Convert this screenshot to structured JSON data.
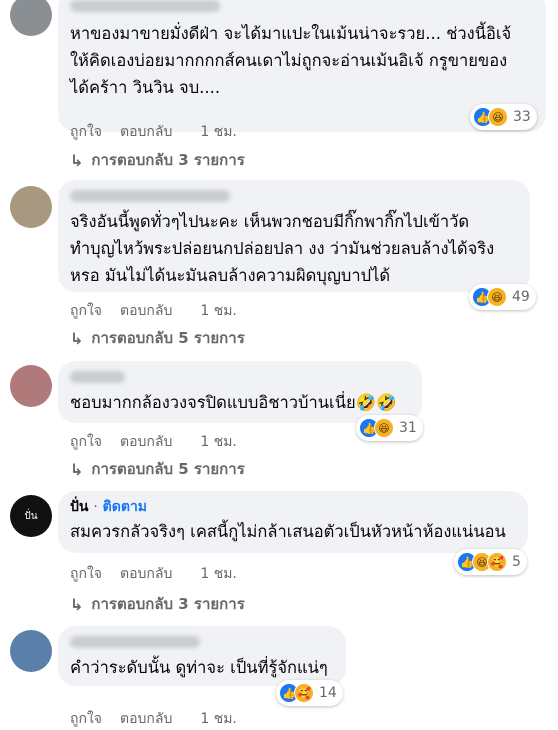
{
  "comments": [
    {
      "text": "หาของมาขายมั่งดีฝ่า จะได้มาแปะในเม้นน่าจะรวย... ช่วงนี้อิเจ้\nให้คิดเองบ่อยมากกกกส์คนเดาไม่ถูกจะอ่านเม้นอิเจ้ กรูขายของ\nได้คร้าา วินวิน จบ....",
      "reaction_count": "33",
      "reactions": [
        "like-icon",
        "haha-icon"
      ],
      "actions": {
        "like": "ถูกใจ",
        "reply": "ตอบกลับ",
        "time": "1 ชม."
      },
      "replies": "การตอบกลับ 3 รายการ",
      "avatar_color": "#8a8f93"
    },
    {
      "text": "จริงอันนี้พูดทั่วๆไปนะคะ เห็นพวกชอบมีกิ๊กพากิ๊กไปเข้าวัด\nทำบุญไหว้พระปล่อยนกปล่อยปลา งง ว่ามันช่วยลบล้างได้จริง\nหรอ มันไม่ได้นะมันลบล้างความผิดบุญบาปได้",
      "reaction_count": "49",
      "reactions": [
        "like-icon",
        "haha-icon"
      ],
      "actions": {
        "like": "ถูกใจ",
        "reply": "ตอบกลับ",
        "time": "1 ชม."
      },
      "replies": "การตอบกลับ 5 รายการ",
      "avatar_color": "#a89880"
    },
    {
      "text": "ชอบมากกล้องวงจรปิดแบบอิชาวบ้านเนี่ย🤣🤣",
      "reaction_count": "31",
      "reactions": [
        "like-icon",
        "haha-icon"
      ],
      "actions": {
        "like": "ถูกใจ",
        "reply": "ตอบกลับ",
        "time": "1 ชม."
      },
      "replies": "การตอบกลับ 5 รายการ",
      "avatar_color": "#b07a7a"
    },
    {
      "author": "ปั่น",
      "separator": "·",
      "follow": "ติดตาม",
      "avatar_text": "ปั่น",
      "text": "สมควรกลัวจริงๆ เคสนี้กูไม่กล้าเสนอตัวเป็นหัวหน้าห้องแน่นอน",
      "reaction_count": "5",
      "reactions": [
        "like-icon",
        "haha-icon",
        "care-icon"
      ],
      "actions": {
        "like": "ถูกใจ",
        "reply": "ตอบกลับ",
        "time": "1 ชม."
      },
      "replies": "การตอบกลับ 3 รายการ",
      "avatar_color": "#111111"
    },
    {
      "text": "คำว่าระดับนั้น ดูท่าจะ เป็นที่รู้จักแน่ๆ",
      "reaction_count": "14",
      "reactions": [
        "like-icon",
        "care-icon"
      ],
      "actions": {
        "like": "ถูกใจ",
        "reply": "ตอบกลับ",
        "time": "1 ชม."
      },
      "avatar_color": "#5a7fa8"
    }
  ]
}
